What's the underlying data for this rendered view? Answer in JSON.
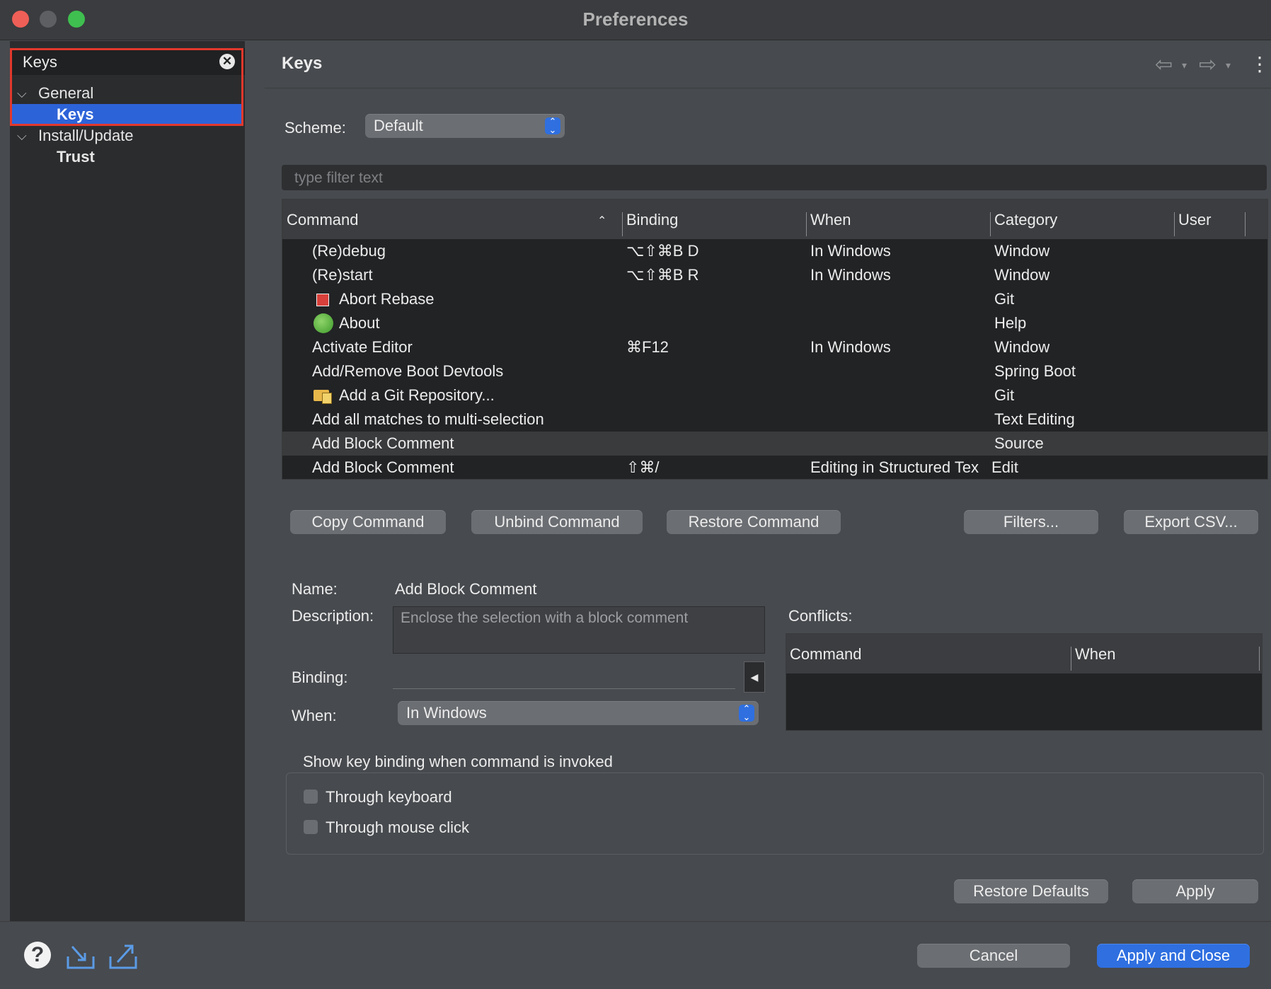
{
  "window": {
    "title": "Preferences",
    "traffic_colors": [
      "#ee5f57",
      "#5d5f62",
      "#3fbf4f"
    ]
  },
  "sidebar": {
    "filter_value": "Keys",
    "items": [
      {
        "label": "General",
        "expanded": true
      },
      {
        "label": "Keys",
        "selected": true
      },
      {
        "label": "Install/Update",
        "expanded": true
      },
      {
        "label": "Trust"
      }
    ]
  },
  "main": {
    "title": "Keys",
    "scheme_label": "Scheme:",
    "scheme_value": "Default",
    "filter_placeholder": "type filter text",
    "table": {
      "columns": [
        "Command",
        "Binding",
        "When",
        "Category",
        "User"
      ],
      "rows": [
        {
          "command": "(Re)debug",
          "binding": "⌥⇧⌘B D",
          "when": "In Windows",
          "category": "Window",
          "icon": ""
        },
        {
          "command": "(Re)start",
          "binding": "⌥⇧⌘B R",
          "when": "In Windows",
          "category": "Window",
          "icon": ""
        },
        {
          "command": "Abort Rebase",
          "binding": "",
          "when": "",
          "category": "Git",
          "icon": "abort-icon"
        },
        {
          "command": "About",
          "binding": "",
          "when": "",
          "category": "Help",
          "icon": "spring-icon"
        },
        {
          "command": "Activate Editor",
          "binding": "⌘F12",
          "when": "In Windows",
          "category": "Window",
          "icon": ""
        },
        {
          "command": "Add/Remove Boot Devtools",
          "binding": "",
          "when": "",
          "category": "Spring Boot",
          "icon": ""
        },
        {
          "command": "Add a Git Repository...",
          "binding": "",
          "when": "",
          "category": "Git",
          "icon": "git-repo-icon"
        },
        {
          "command": "Add all matches to multi-selection",
          "binding": "",
          "when": "",
          "category": "Text Editing",
          "icon": ""
        },
        {
          "command": "Add Block Comment",
          "binding": "",
          "when": "",
          "category": "Source",
          "icon": "",
          "selected": true
        },
        {
          "command": "Add Block Comment",
          "binding": "⇧⌘/",
          "when": "Editing in Structured Tex",
          "category": "Edit",
          "icon": ""
        }
      ]
    },
    "buttons": {
      "copy": "Copy Command",
      "unbind": "Unbind Command",
      "restore": "Restore Command",
      "filters": "Filters...",
      "export": "Export CSV..."
    },
    "details": {
      "name_label": "Name:",
      "name_value": "Add Block Comment",
      "description_label": "Description:",
      "description_value": "Enclose the selection with a block comment",
      "binding_label": "Binding:",
      "binding_value": "",
      "when_label": "When:",
      "when_value": "In Windows",
      "conflicts_label": "Conflicts:",
      "conflicts_columns": [
        "Command",
        "When"
      ]
    },
    "show_binding": {
      "title": "Show key binding when command is invoked",
      "options": [
        {
          "label": "Through keyboard",
          "checked": false
        },
        {
          "label": "Through mouse click",
          "checked": false
        }
      ]
    },
    "restore_defaults": "Restore Defaults",
    "apply": "Apply"
  },
  "footer": {
    "cancel": "Cancel",
    "apply_close": "Apply and Close"
  }
}
